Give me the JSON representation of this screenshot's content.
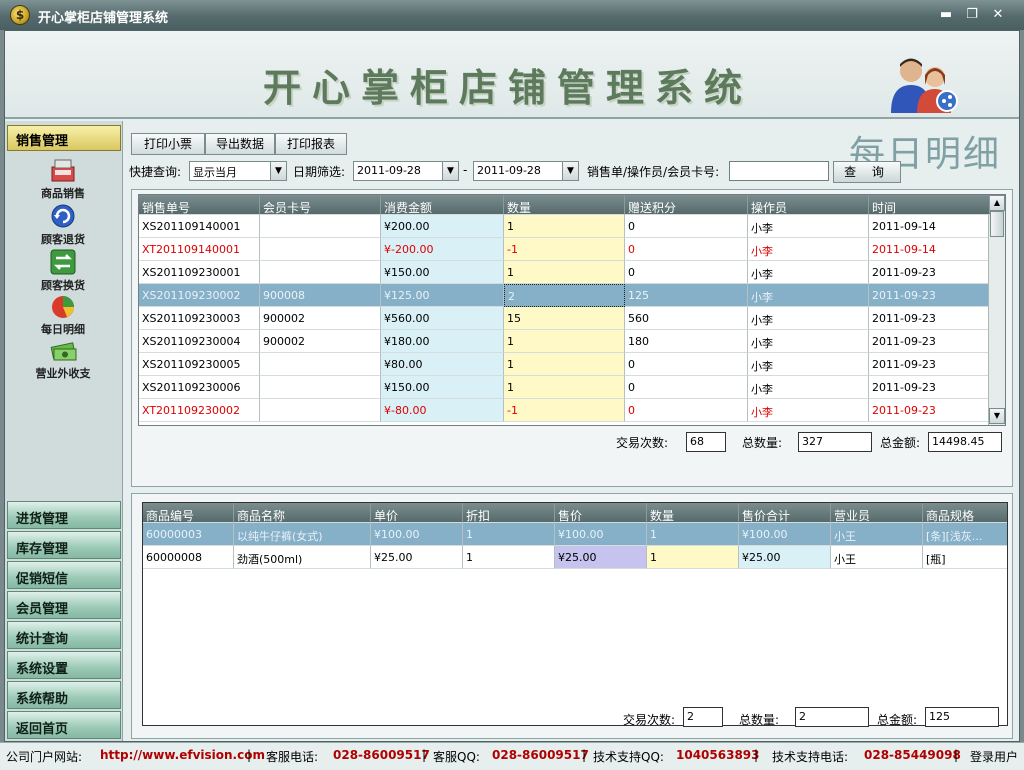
{
  "window": {
    "title": "开心掌柜店铺管理系统",
    "minimize": "▬",
    "maximize": "❐",
    "close": "✕"
  },
  "banner": {
    "brand": "开心掌柜店铺管理系统"
  },
  "sidebar": {
    "header": "销售管理",
    "items": [
      {
        "label": "商品销售",
        "icon": "register-icon"
      },
      {
        "label": "顾客退货",
        "icon": "return-icon"
      },
      {
        "label": "顾客换货",
        "icon": "exchange-icon"
      },
      {
        "label": "每日明细",
        "icon": "pie-chart-icon"
      },
      {
        "label": "营业外收支",
        "icon": "money-icon"
      }
    ],
    "menus": [
      "进货管理",
      "库存管理",
      "促销短信",
      "会员管理",
      "统计查询",
      "系统设置",
      "系统帮助",
      "返回首页"
    ]
  },
  "toolbar": {
    "print_receipt": "打印小票",
    "export": "导出数据",
    "print_report": "打印报表"
  },
  "page_heading": "每日明细",
  "filters": {
    "quick_label": "快捷查询:",
    "quick_value": "显示当月",
    "date_label": "日期筛选:",
    "date_from": "2011-09-28",
    "date_sep": "-",
    "date_to": "2011-09-28",
    "search_label": "销售单/操作员/会员卡号:",
    "search_value": "",
    "query_button": "查 询"
  },
  "sales_table": {
    "columns": [
      "销售单号",
      "会员卡号",
      "消费金额",
      "数量",
      "赠送积分",
      "操作员",
      "时间"
    ],
    "rows": [
      [
        "XS201109140001",
        "",
        "¥200.00",
        "1",
        "0",
        "小李",
        "2011-09-14"
      ],
      [
        "XT201109140001",
        "",
        "¥-200.00",
        "-1",
        "0",
        "小李",
        "2011-09-14"
      ],
      [
        "XS201109230001",
        "",
        "¥150.00",
        "1",
        "0",
        "小李",
        "2011-09-23"
      ],
      [
        "XS201109230002",
        "900008",
        "¥125.00",
        "2",
        "125",
        "小李",
        "2011-09-23"
      ],
      [
        "XS201109230003",
        "900002",
        "¥560.00",
        "15",
        "560",
        "小李",
        "2011-09-23"
      ],
      [
        "XS201109230004",
        "900002",
        "¥180.00",
        "1",
        "180",
        "小李",
        "2011-09-23"
      ],
      [
        "XS201109230005",
        "",
        "¥80.00",
        "1",
        "0",
        "小李",
        "2011-09-23"
      ],
      [
        "XS201109230006",
        "",
        "¥150.00",
        "1",
        "0",
        "小李",
        "2011-09-23"
      ],
      [
        "XT201109230002",
        "",
        "¥-80.00",
        "-1",
        "0",
        "小李",
        "2011-09-23"
      ]
    ],
    "summary": {
      "count_label": "交易次数:",
      "count": "68",
      "qty_label": "总数量:",
      "qty": "327",
      "amount_label": "总金额:",
      "amount": "14498.45"
    }
  },
  "detail_table": {
    "columns": [
      "商品编号",
      "商品名称",
      "单价",
      "折扣",
      "售价",
      "数量",
      "售价合计",
      "营业员",
      "商品规格"
    ],
    "rows": [
      [
        "60000003",
        "以纯牛仔裤(女式)",
        "¥100.00",
        "1",
        "¥100.00",
        "1",
        "¥100.00",
        "小王",
        "[条][浅灰..."
      ],
      [
        "60000008",
        "劲酒(500ml)",
        "¥25.00",
        "1",
        "¥25.00",
        "1",
        "¥25.00",
        "小王",
        "[瓶]"
      ]
    ],
    "summary": {
      "count_label": "交易次数:",
      "count": "2",
      "qty_label": "总数量:",
      "qty": "2",
      "amount_label": "总金额:",
      "amount": "125"
    }
  },
  "status": {
    "site_label": "公司门户网站:",
    "site": "http://www.efvision.com",
    "phone_label": "客服电话:",
    "phone": "028-86009517",
    "qq_label": "客服QQ:",
    "qq": "028-86009517",
    "tech_qq_label": "技术支持QQ:",
    "tech_qq": "1040563893",
    "tech_phone_label": "技术支持电话:",
    "tech_phone": "028-85449098",
    "login": "登录用户"
  }
}
